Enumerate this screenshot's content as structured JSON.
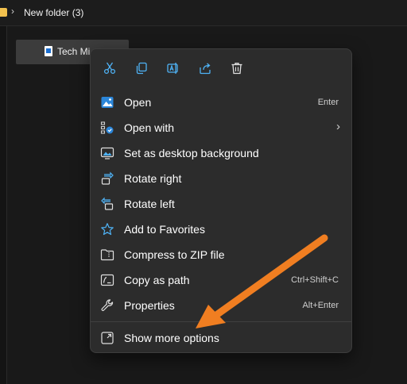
{
  "breadcrumb": {
    "folder_name": "New folder (3)"
  },
  "file": {
    "name": "Tech Mi"
  },
  "menu": {
    "quick_actions": [
      {
        "name": "cut",
        "icon": "scissors-icon"
      },
      {
        "name": "copy",
        "icon": "copy-icon"
      },
      {
        "name": "rename",
        "icon": "rename-icon"
      },
      {
        "name": "share",
        "icon": "share-icon"
      },
      {
        "name": "delete",
        "icon": "trash-icon"
      }
    ],
    "items": [
      {
        "label": "Open",
        "shortcut": "Enter",
        "icon": "image-open-icon"
      },
      {
        "label": "Open with",
        "shortcut": "",
        "icon": "open-with-icon",
        "submenu": true
      },
      {
        "label": "Set as desktop background",
        "shortcut": "",
        "icon": "desktop-background-icon"
      },
      {
        "label": "Rotate right",
        "shortcut": "",
        "icon": "rotate-right-icon"
      },
      {
        "label": "Rotate left",
        "shortcut": "",
        "icon": "rotate-left-icon"
      },
      {
        "label": "Add to Favorites",
        "shortcut": "",
        "icon": "star-icon"
      },
      {
        "label": "Compress to ZIP file",
        "shortcut": "",
        "icon": "zip-folder-icon"
      },
      {
        "label": "Copy as path",
        "shortcut": "Ctrl+Shift+C",
        "icon": "copy-path-icon"
      },
      {
        "label": "Properties",
        "shortcut": "Alt+Enter",
        "icon": "wrench-icon"
      }
    ],
    "more_options": {
      "label": "Show more options",
      "icon": "expand-icon"
    }
  },
  "colors": {
    "menu_background": "#2c2c2c",
    "icon_accent": "#4fb3f6",
    "annotation_arrow": "#f07e21"
  }
}
